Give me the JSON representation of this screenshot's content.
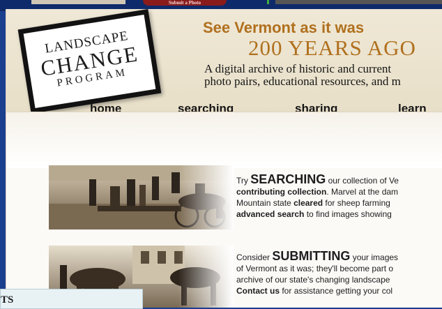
{
  "top_strip": {
    "submit_tab": "Submit a Photo"
  },
  "logo": {
    "line1": "LANDSCAPE",
    "line2": "CHANGE",
    "line3": "PROGRAM"
  },
  "header": {
    "headline1": "See Vermont as it was",
    "headline2": "200 YEARS AGO",
    "tagline_line1": "A digital archive of historic and current",
    "tagline_line2": "photo pairs, educational resources, and m"
  },
  "nav": [
    "home",
    "searching",
    "sharing",
    "learn"
  ],
  "blocks": {
    "search": {
      "line1_prefix": "Try ",
      "line1_big": "SEARCHING",
      "line1_suffix": " our collection of Ve",
      "line2_bold": "contributing collection",
      "line2_rest": ". Marvel at the dam",
      "line3_prefix": "Mountain state ",
      "line3_bold": "cleared",
      "line3_suffix": " for sheep farming",
      "line4_bold": "advanced search",
      "line4_rest": " to find images showing"
    },
    "submit": {
      "line1_prefix": "Consider ",
      "line1_big": "SUBMITTING",
      "line1_suffix": " your images",
      "line2": "of Vermont as it was; they'll become part o",
      "line3": "archive of our state's changing landscape",
      "line4_bold": "Contact us",
      "line4_rest": " for assistance getting your col"
    }
  },
  "popup": {
    "text": "TS"
  },
  "colors": {
    "accent": "#b0701e",
    "background_blue": "#1b3f8f"
  }
}
